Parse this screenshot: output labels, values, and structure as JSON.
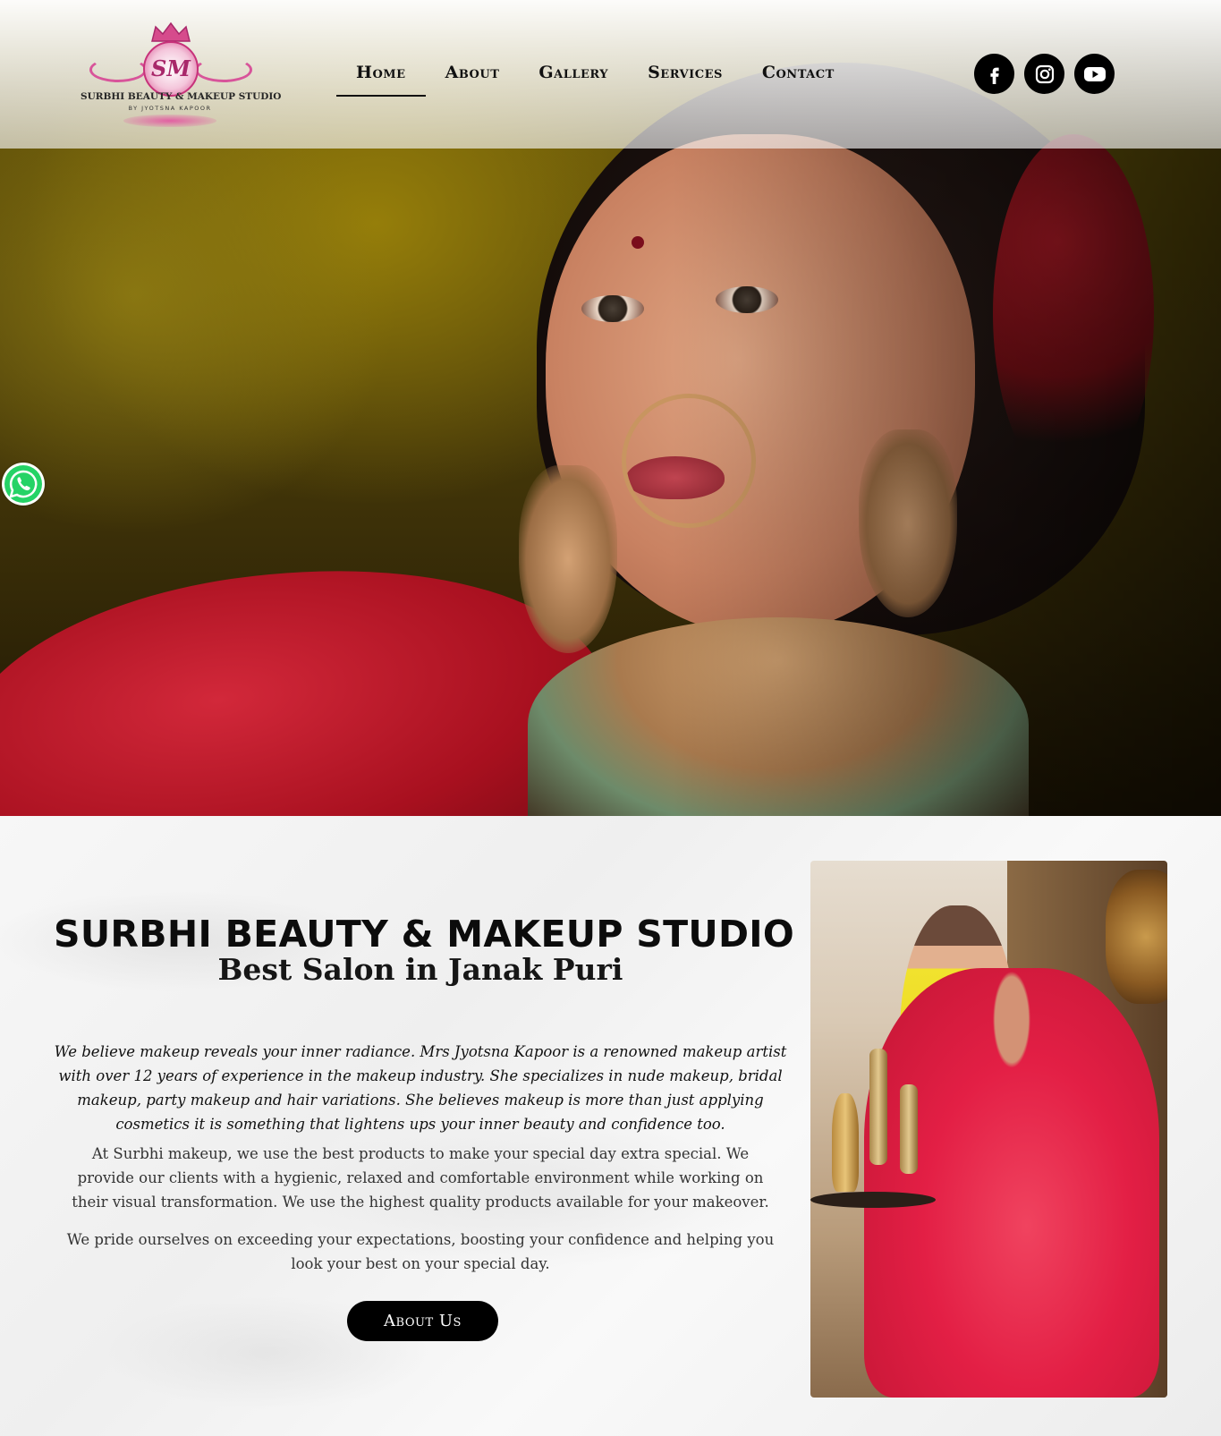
{
  "header": {
    "logo": {
      "monogram": "SM",
      "name": "SURBHI BEAUTY & MAKEUP STUDIO",
      "byline": "BY JYOTSNA KAPOOR"
    },
    "nav": [
      {
        "label": "Home",
        "active": true
      },
      {
        "label": "About",
        "active": false
      },
      {
        "label": "Gallery",
        "active": false
      },
      {
        "label": "Services",
        "active": false
      },
      {
        "label": "Contact",
        "active": false
      }
    ],
    "social": [
      {
        "icon": "facebook-icon"
      },
      {
        "icon": "instagram-icon"
      },
      {
        "icon": "youtube-icon"
      }
    ]
  },
  "floating": {
    "icon": "whatsapp-icon",
    "color": "#25d366"
  },
  "about": {
    "title": "SURBHI BEAUTY & MAKEUP STUDIO",
    "subtitle": "Best Salon in Janak Puri",
    "lead": "We believe makeup reveals your inner radiance. Mrs Jyotsna Kapoor is a renowned makeup artist with over 12 years of experience in the makeup industry. She specializes in nude makeup, bridal makeup, party makeup and hair variations. She believes makeup is more than just applying cosmetics it is something that lightens ups your inner beauty and confidence too.",
    "paragraph1": "At Surbhi makeup, we use the best products to make your special day extra special. We provide our clients with a hygienic, relaxed and comfortable environment while working on their visual transformation. We use the highest quality products available for your makeover.",
    "paragraph2": "We pride ourselves on exceeding your expectations, boosting your confidence and helping you look your best on your special day.",
    "button_label": "About Us"
  },
  "colors": {
    "accent": "#000000",
    "logo_pink": "#d64b8c",
    "hero_gold": "#6b5a08",
    "bridal_red": "#e31f45"
  }
}
